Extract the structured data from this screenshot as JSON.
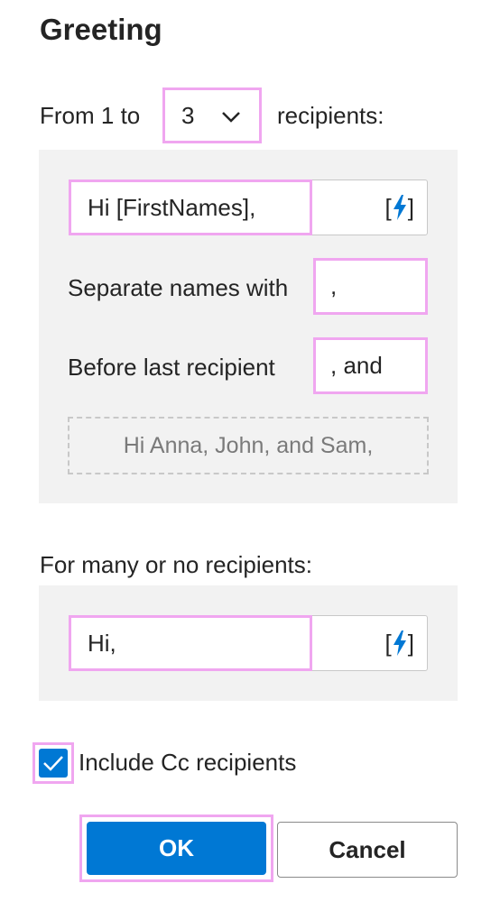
{
  "title": "Greeting",
  "range": {
    "prefix": "From 1 to",
    "selected_value": "3",
    "suffix": "recipients:"
  },
  "few": {
    "greeting_value": "Hi [FirstNames],",
    "insert_icon": "lightning-bolt-icon",
    "separate_label": "Separate names with",
    "separate_value": ",",
    "before_last_label": "Before last recipient",
    "before_last_value": ", and",
    "preview": "Hi Anna, John, and Sam,"
  },
  "many": {
    "label": "For many or no recipients:",
    "greeting_value": "Hi,",
    "insert_icon": "lightning-bolt-icon"
  },
  "include_cc": {
    "label": "Include Cc recipients",
    "checked": true
  },
  "buttons": {
    "ok": "OK",
    "cancel": "Cancel"
  },
  "colors": {
    "accent": "#0078d4",
    "highlight": "#f0a6f0",
    "panel": "#f2f2f2"
  }
}
